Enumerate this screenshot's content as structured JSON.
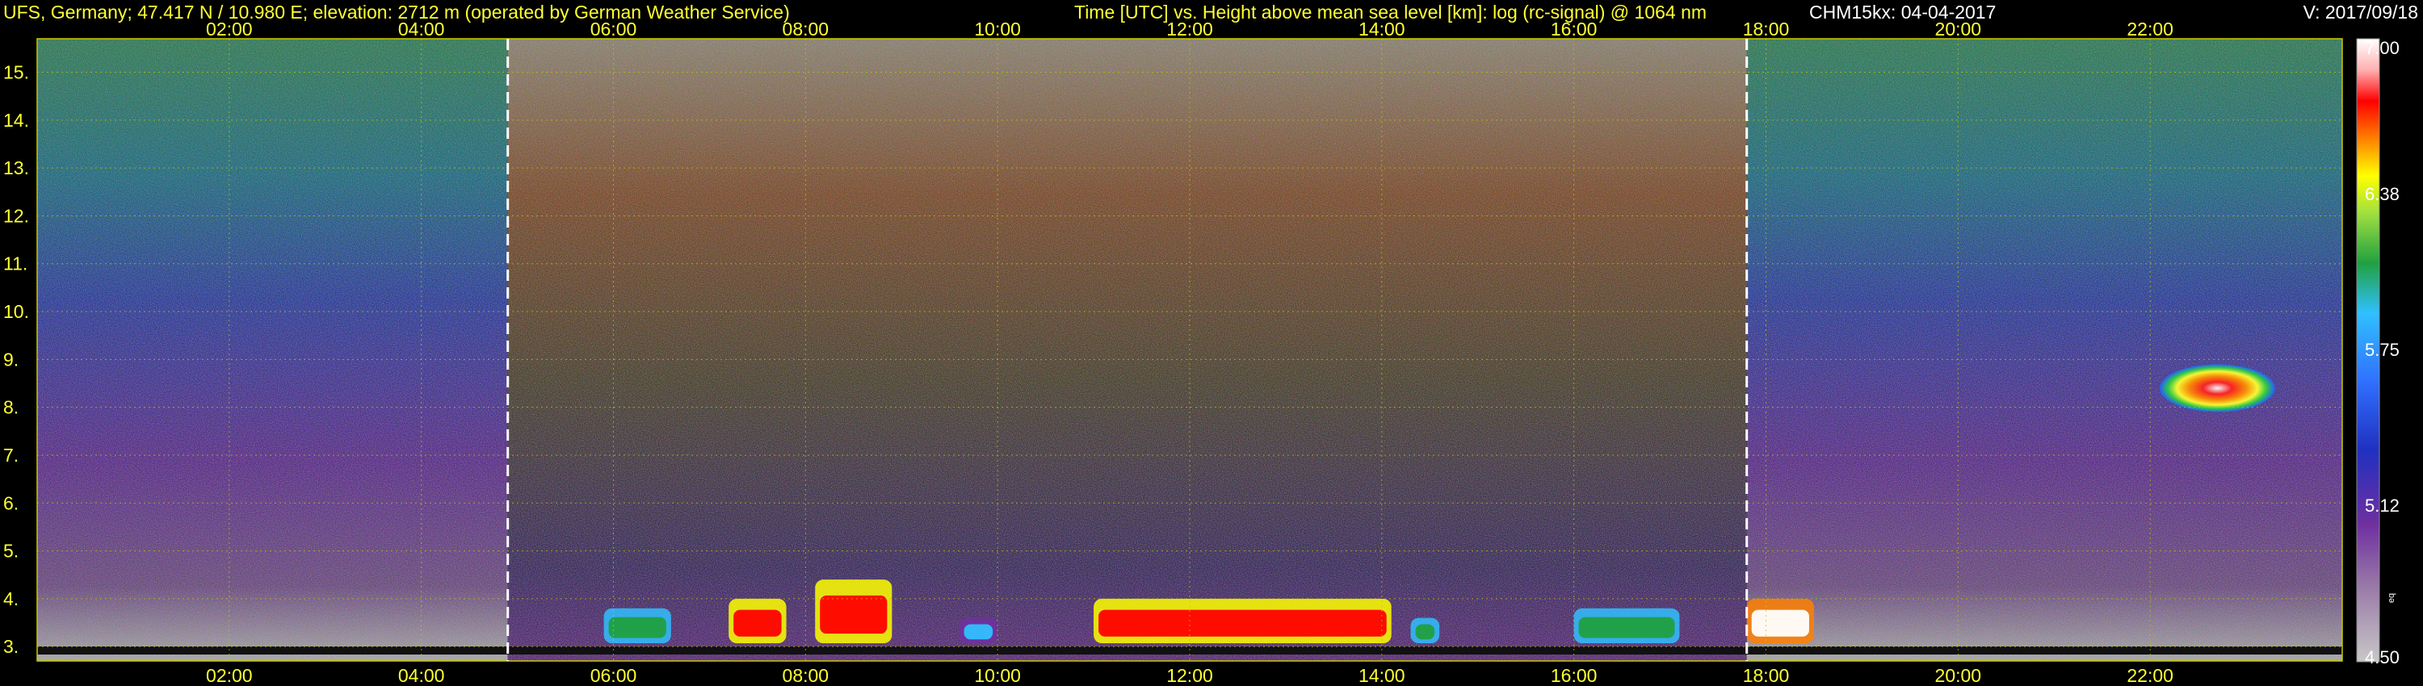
{
  "header": {
    "station": "UFS, Germany; 47.417 N / 10.980 E; elevation: 2712 m  (operated by German Weather Service)",
    "title": "Time [UTC] vs. Height above mean sea level [km]: log (rc-signal) @ 1064 nm",
    "instrument_date": "CHM15kx: 04-04-2017",
    "version": "V: 2017/09/18"
  },
  "colorbar": {
    "ticks": [
      "7.00",
      "6.38",
      "5.75",
      "5.12",
      "4.50"
    ],
    "note": "eq"
  },
  "chart_data": {
    "type": "heatmap",
    "x_ticks": [
      "02:00",
      "04:00",
      "06:00",
      "08:00",
      "10:00",
      "12:00",
      "14:00",
      "16:00",
      "18:00",
      "20:00",
      "22:00"
    ],
    "y_ticks": [
      "3.",
      "4.",
      "5.",
      "6.",
      "7.",
      "8.",
      "9.",
      "10.",
      "11.",
      "12.",
      "13.",
      "14.",
      "15."
    ],
    "xlim_hours": [
      0,
      24
    ],
    "ylim_km": [
      2.7,
      15.7
    ],
    "grid": true,
    "colorbar_range": [
      4.5,
      7.0
    ],
    "colormap": [
      "#c8c8c8",
      "#7030a0",
      "#3050ff",
      "#30c0ff",
      "#20a040",
      "#ffff00",
      "#ff8000",
      "#ff0000",
      "#ffffff"
    ],
    "night_day_markers_hours": [
      4.9,
      17.8
    ],
    "boundary_layer_features": [
      {
        "start": 5.9,
        "end": 6.6,
        "top_km": 3.8,
        "level": 5.9
      },
      {
        "start": 7.2,
        "end": 7.8,
        "top_km": 4.0,
        "level": 6.6
      },
      {
        "start": 8.1,
        "end": 8.9,
        "top_km": 4.4,
        "level": 6.8
      },
      {
        "start": 9.6,
        "end": 10.0,
        "top_km": 3.6,
        "level": 5.3
      },
      {
        "start": 11.0,
        "end": 14.1,
        "top_km": 4.0,
        "level": 6.7
      },
      {
        "start": 14.3,
        "end": 14.6,
        "top_km": 3.6,
        "level": 5.9
      },
      {
        "start": 16.0,
        "end": 17.1,
        "top_km": 3.8,
        "level": 5.9
      },
      {
        "start": 17.8,
        "end": 18.5,
        "top_km": 4.0,
        "level": 6.9
      }
    ],
    "cloud_layers": [
      {
        "start": 22.1,
        "end": 23.3,
        "base_km": 7.9,
        "top_km": 8.9,
        "level": 6.7
      }
    ]
  }
}
